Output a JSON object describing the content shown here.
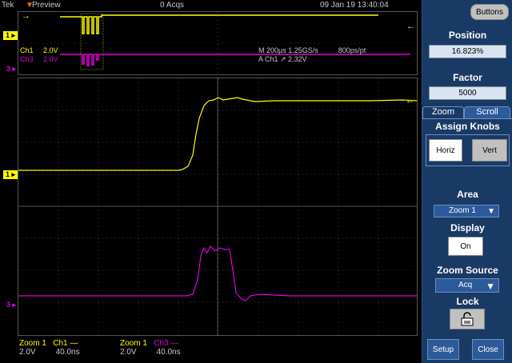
{
  "topbar": {
    "brand": "Tek",
    "mode": "Preview",
    "acq": "0 Acqs",
    "datetime": "09 Jan 19 13:40:04"
  },
  "overview": {
    "ch1_label": "Ch1",
    "ch1_scale": "2.0V",
    "ch3_label": "Ch3",
    "ch3_scale": "2.0V",
    "timebase": "M 200µs 1.25GS/s",
    "record": "800ps/pt",
    "trigger": "A  Ch1  ↗  2.32V"
  },
  "markers": {
    "ch1": "1",
    "ch3": "3"
  },
  "readouts": [
    {
      "zoom": "Zoom 1",
      "zoom_scale": "2.0V",
      "ch": "Ch1 —",
      "ch_time": "40.0ns"
    },
    {
      "zoom": "Zoom 1",
      "zoom_scale": "2.0V",
      "ch": "Ch3 —",
      "ch_time": "40.0ns"
    }
  ],
  "side": {
    "buttons_label": "Buttons",
    "position_title": "Position",
    "position_value": "16.823%",
    "factor_title": "Factor",
    "factor_value": "5000",
    "tab_zoom": "Zoom",
    "tab_scroll": "Scroll",
    "assign_title": "Assign Knobs",
    "horiz": "Horiz",
    "vert": "Vert",
    "area_title": "Area",
    "area_value": "Zoom 1",
    "display_title": "Display",
    "display_value": "On",
    "source_title": "Zoom Source",
    "source_value": "Acq",
    "lock_title": "Lock",
    "setup": "Setup",
    "close": "Close"
  },
  "colors": {
    "ch1": "#ffff00",
    "ch3": "#e000e0",
    "panel": "#1a3a66"
  }
}
